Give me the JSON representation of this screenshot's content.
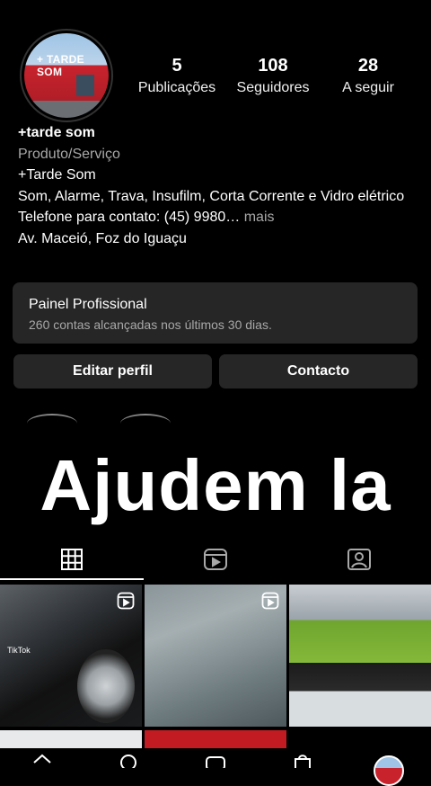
{
  "profile": {
    "avatar_sign": "+ TARDE SOM",
    "stats": [
      {
        "num": "5",
        "label": "Publicações"
      },
      {
        "num": "108",
        "label": "Seguidores"
      },
      {
        "num": "28",
        "label": "A seguir"
      }
    ],
    "name": "+tarde som",
    "category": "Produto/Serviço",
    "bio_line1": "+Tarde Som",
    "bio_line2": "Som, Alarme, Trava, Insufilm, Corta Corrente e Vidro elétrico",
    "bio_phone": "Telefone para contato: (45) 9980…",
    "bio_more": " mais",
    "bio_address": "Av. Maceió, Foz do Iguaçu"
  },
  "dashboard": {
    "title": "Painel Profissional",
    "subtitle": "260 contas alcançadas nos últimos 30 dias."
  },
  "buttons": {
    "edit_profile": "Editar perfil",
    "contact": "Contacto"
  },
  "overlay_text": "Ajudem la",
  "tabs": [
    {
      "icon": "grid-icon",
      "active": true
    },
    {
      "icon": "reels-icon",
      "active": false
    },
    {
      "icon": "tagged-icon",
      "active": false
    }
  ],
  "grid": [
    {
      "type": "reel",
      "watermark": "TikTok",
      "theme": "black car with wheel"
    },
    {
      "type": "reel",
      "theme": "car window glass"
    },
    {
      "type": "photo",
      "theme": "car audio products on shelf"
    }
  ],
  "bottom_nav": [
    "home-icon",
    "search-icon",
    "reels-icon",
    "shop-icon",
    "profile-avatar"
  ]
}
